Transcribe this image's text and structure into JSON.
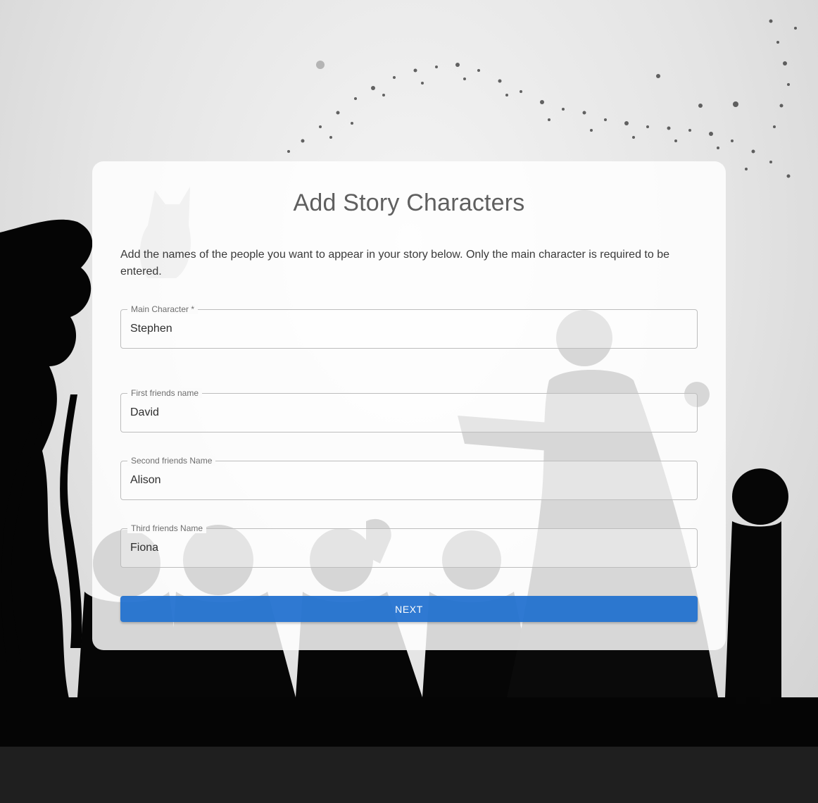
{
  "page": {
    "title": "Add Story Characters",
    "intro": "Add the names of the people you want to appear in your story below. Only the main character is required to be entered."
  },
  "form": {
    "fields": [
      {
        "label": "Main Character *",
        "value": "Stephen"
      },
      {
        "label": "First friends name",
        "value": "David"
      },
      {
        "label": "Second friends Name",
        "value": "Alison"
      },
      {
        "label": "Third friends Name",
        "value": "Fiona"
      }
    ],
    "next_label": "NEXT"
  },
  "colors": {
    "accent": "#1e6fcf",
    "title_text": "#5f5f5f",
    "border": "#bdbdbd"
  }
}
